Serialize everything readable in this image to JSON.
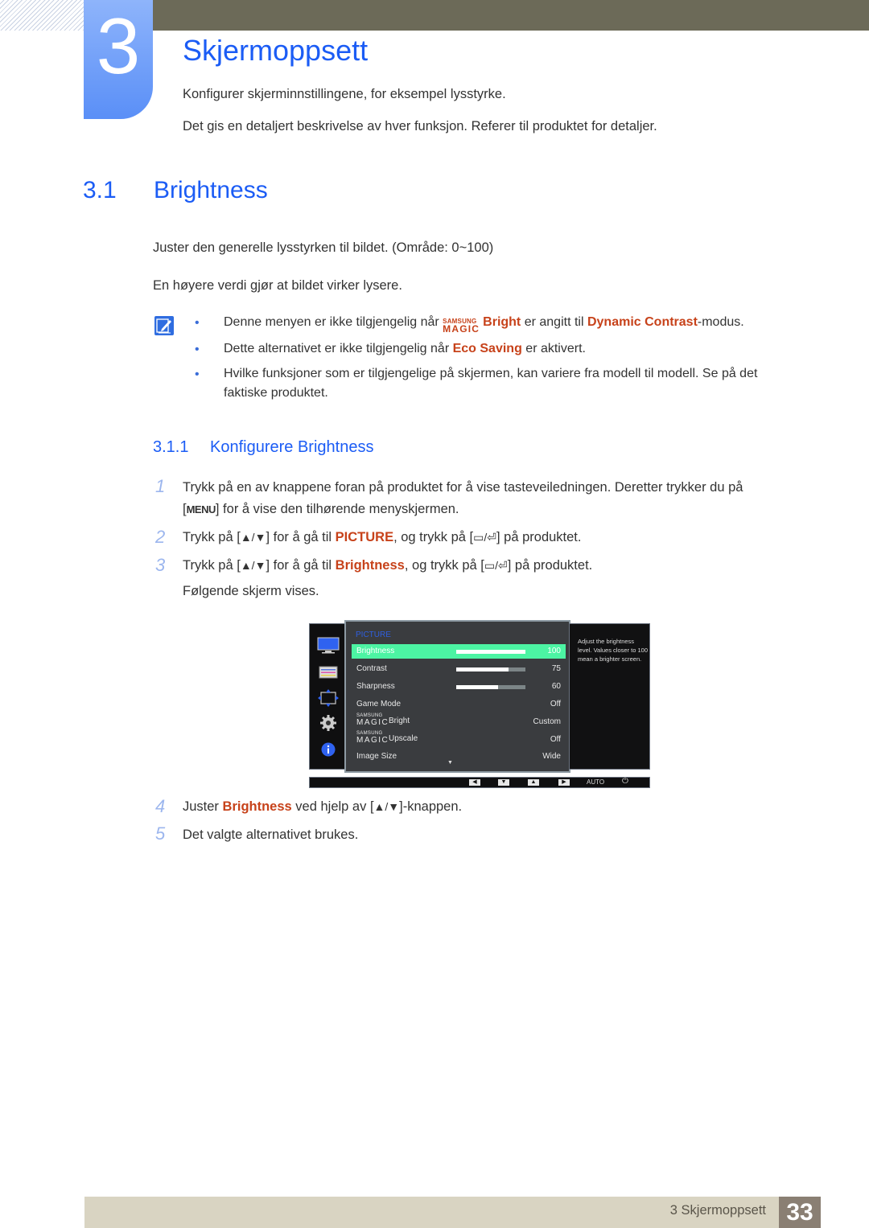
{
  "chapter": {
    "number": "3",
    "title": "Skjermoppsett",
    "intro": [
      "Konfigurer skjerminnstillingene, for eksempel lysstyrke.",
      "Det gis en detaljert beskrivelse av hver funksjon. Referer til produktet for detaljer."
    ]
  },
  "section": {
    "number": "3.1",
    "title": "Brightness",
    "paragraphs": [
      "Juster den generelle lysstyrken til bildet. (Område: 0~100)",
      "En høyere verdi gjør at bildet virker lysere."
    ]
  },
  "notes": {
    "icon": "note-pencil-icon",
    "items": [
      {
        "pre": "Denne menyen er ikke tilgjengelig når ",
        "magic_small": "SAMSUNG",
        "magic_big": "MAGIC",
        "highlight1": "Bright",
        "mid": " er angitt til ",
        "highlight2": "Dynamic Contrast",
        "post": "-modus."
      },
      {
        "pre": "Dette alternativet er ikke tilgjengelig når ",
        "highlight": "Eco Saving",
        "post": " er aktivert."
      },
      {
        "text": "Hvilke funksjoner som er tilgjengelige på skjermen, kan variere fra modell til modell. Se på det faktiske produktet."
      }
    ]
  },
  "subsection": {
    "number": "3.1.1",
    "title": "Konfigurere Brightness"
  },
  "steps": [
    {
      "num": "1",
      "line1": "Trykk på en av knappene foran på produktet for å vise tasteveiledningen. Deretter trykker du på",
      "key": "MENU",
      "line2": " for å vise den tilhørende menyskjermen."
    },
    {
      "num": "2",
      "pre": "Trykk på [",
      "keys": "▲/▼",
      "mid": "] for å gå til ",
      "highlight": "PICTURE",
      "mid2": ", og trykk på [",
      "keys2": "▭/⏎",
      "post": "] på produktet."
    },
    {
      "num": "3",
      "pre": "Trykk på [",
      "keys": "▲/▼",
      "mid": "] for å gå til ",
      "highlight": "Brightness",
      "mid2": ", og trykk på [",
      "keys2": "▭/⏎",
      "post": "] på produktet.",
      "line2": "Følgende skjerm vises."
    },
    {
      "num": "4",
      "pre": "Juster ",
      "highlight": "Brightness",
      "mid": " ved hjelp av [",
      "keys": "▲/▼",
      "post": "]-knappen."
    },
    {
      "num": "5",
      "text": "Det valgte alternativet brukes."
    }
  ],
  "osd": {
    "category": "PICTURE",
    "side_icons": [
      "monitor-icon",
      "picture-settings-icon",
      "size-position-icon",
      "gear-icon",
      "info-icon"
    ],
    "rows": [
      {
        "label": "Brightness",
        "value": "100",
        "bar": 1.0,
        "selected": true
      },
      {
        "label": "Contrast",
        "value": "75",
        "bar": 0.75
      },
      {
        "label": "Sharpness",
        "value": "60",
        "bar": 0.6
      },
      {
        "label": "Game Mode",
        "value": "Off"
      },
      {
        "label": "Bright",
        "value": "Custom",
        "magic": true
      },
      {
        "label": "Upscale",
        "value": "Off",
        "magic": true
      },
      {
        "label": "Image Size",
        "value": "Wide"
      }
    ],
    "magic_small": "SAMSUNG",
    "magic_big": "MAGIC",
    "more_indicator": "▼",
    "help_text": "Adjust the brightness level. Values closer to 100 mean a brighter screen.",
    "buttons": [
      "◀",
      "▼",
      "▲",
      "▶"
    ],
    "auto_label": "AUTO",
    "power_glyph": "⏻"
  },
  "footer": {
    "label": "3 Skjermoppsett",
    "page": "33"
  }
}
